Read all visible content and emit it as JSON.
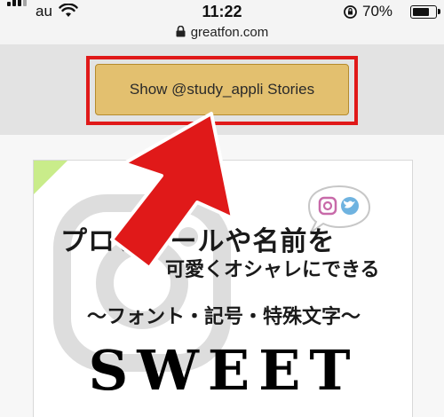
{
  "status_bar": {
    "carrier": "au",
    "time": "11:22",
    "battery_percent": "70%",
    "battery_level": 0.7,
    "icons": [
      "signal-bars-icon",
      "wifi-icon",
      "orientation-lock-icon",
      "battery-icon"
    ]
  },
  "url_bar": {
    "domain": "greatfon.com",
    "icon": "padlock-icon"
  },
  "stories_button": {
    "label": "Show @study_appli Stories"
  },
  "annotation": {
    "highlight_color": "#e01919",
    "arrow_color": "#e01919"
  },
  "card": {
    "title_line_1": "プロフィールや名前を",
    "title_line_2": "可愛くオシャレにできる",
    "subtitle": "〜フォント・記号・特殊文字〜",
    "decorative_text": "SWEET",
    "accent_color": "#c9ec8a"
  },
  "colors": {
    "button_bg": "#e3c06f",
    "band_bg": "#e3e3e3"
  }
}
